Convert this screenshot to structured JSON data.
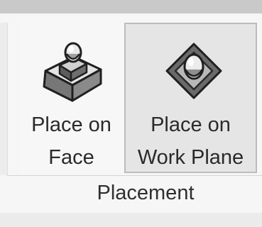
{
  "placement_panel": {
    "buttons": [
      {
        "icon": "place-on-face-icon",
        "label_line1": "Place on",
        "label_line2": "Face"
      },
      {
        "icon": "place-on-work-plane-icon",
        "label_line1": "Place on",
        "label_line2": "Work Plane"
      }
    ],
    "group_title": "Placement"
  },
  "colors": {
    "panel_background": "#f6f6f6",
    "selected_button_background": "#e5e5e5",
    "selected_button_border": "#bcbcbc",
    "label_text": "#2a2a2a"
  }
}
